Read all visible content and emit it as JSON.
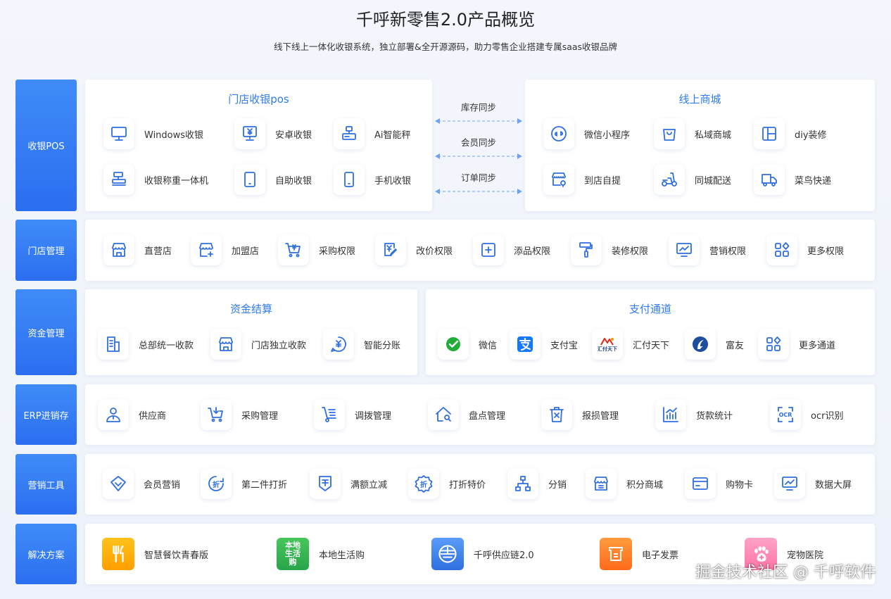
{
  "header": {
    "title": "千呼新零售2.0产品概览",
    "subtitle": "线下线上一体化收银系统，独立部署&全开源源码，助力零售企业搭建专属saas收银品牌"
  },
  "rows": {
    "pos": "收银POS",
    "store": "门店管理",
    "finance": "资金管理",
    "erp": "ERP进销存",
    "marketing": "营销工具",
    "solutions": "解决方案"
  },
  "pos": {
    "offline": {
      "title": "门店收银pos",
      "items": [
        "Windows收银",
        "安卓收银",
        "Ai智能秤",
        "收银称重一体机",
        "自助收银",
        "手机收银"
      ]
    },
    "sync": [
      "库存同步",
      "会员同步",
      "订单同步"
    ],
    "online": {
      "title": "线上商城",
      "items": [
        "微信小程序",
        "私域商城",
        "diy装修",
        "到店自提",
        "同城配送",
        "菜鸟快递"
      ]
    }
  },
  "store": {
    "items": [
      "直营店",
      "加盟店",
      "采购权限",
      "改价权限",
      "添品权限",
      "装修权限",
      "营销权限",
      "更多权限"
    ]
  },
  "finance": {
    "settlement": {
      "title": "资金结算",
      "items": [
        "总部统一收款",
        "门店独立收款",
        "智能分账"
      ]
    },
    "payment": {
      "title": "支付通道",
      "items": [
        "微信",
        "支付宝",
        "汇付天下",
        "富友",
        "更多通道"
      ],
      "huifu_logo_text": "汇付天下"
    }
  },
  "erp": {
    "items": [
      "供应商",
      "采购管理",
      "调拨管理",
      "盘点管理",
      "报损管理",
      "货款统计",
      "ocr识别"
    ],
    "ocr_icon_text": "OCR"
  },
  "marketing": {
    "items": [
      "会员营销",
      "第二件打折",
      "满额立减",
      "打折特价",
      "分销",
      "积分商城",
      "购物卡",
      "数据大屏"
    ],
    "discount_glyph": "折"
  },
  "solutions": {
    "items": [
      "智慧餐饮青春版",
      "本地生活购",
      "千呼供应链2.0",
      "电子发票",
      "宠物医院"
    ],
    "local_logo_text": "本地生活购"
  },
  "watermark": "掘金技术社区 @ 千呼软件",
  "colors": {
    "accent": "#2f7bf0",
    "label_bg": "#3a85f6"
  }
}
